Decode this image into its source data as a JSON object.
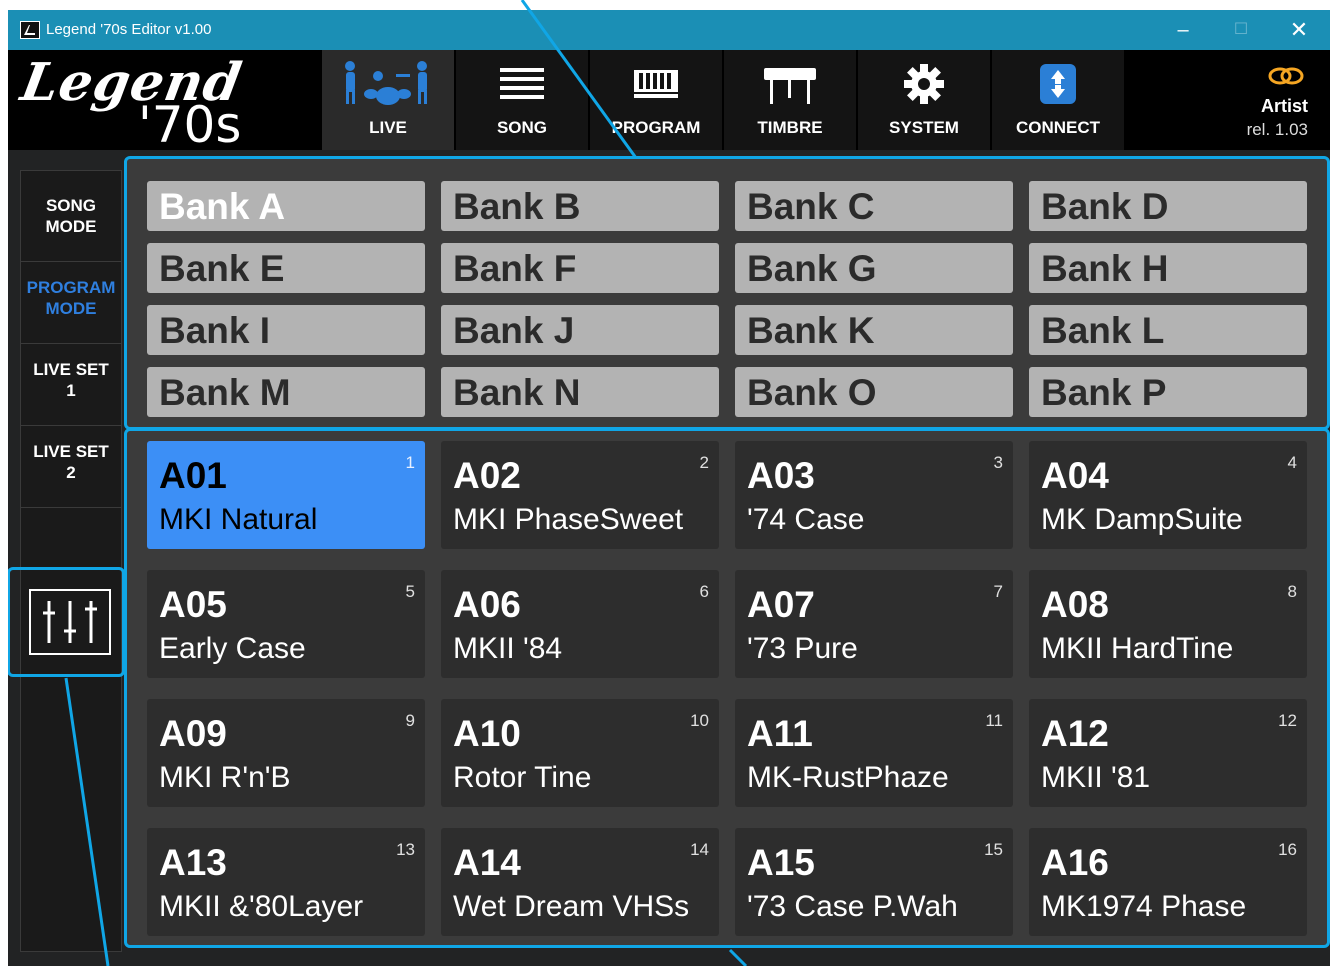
{
  "window": {
    "title": "Legend '70s Editor v1.00",
    "min": "–",
    "max": "☐",
    "close": "✕"
  },
  "logo": {
    "word": "Legend",
    "era": "'70s"
  },
  "tabs": [
    {
      "label": "LIVE",
      "icon": "band-icon",
      "active": true
    },
    {
      "label": "SONG",
      "icon": "list-icon"
    },
    {
      "label": "PROGRAM",
      "icon": "keyboard-icon"
    },
    {
      "label": "TIMBRE",
      "icon": "piano-icon"
    },
    {
      "label": "SYSTEM",
      "icon": "gear-icon"
    },
    {
      "label": "CONNECT",
      "icon": "connect-icon"
    }
  ],
  "account": {
    "level": "Artist",
    "release": "rel. 1.03"
  },
  "sidebar": [
    {
      "line1": "SONG",
      "line2": "MODE"
    },
    {
      "line1": "PROGRAM",
      "line2": "MODE",
      "active": true
    },
    {
      "line1": "LIVE SET",
      "line2": "1"
    },
    {
      "line1": "LIVE SET",
      "line2": "2"
    }
  ],
  "banks": [
    "Bank A",
    "Bank B",
    "Bank C",
    "Bank D",
    "Bank E",
    "Bank F",
    "Bank G",
    "Bank H",
    "Bank I",
    "Bank J",
    "Bank K",
    "Bank L",
    "Bank M",
    "Bank N",
    "Bank O",
    "Bank P"
  ],
  "selected_bank": "Bank A",
  "programs": [
    {
      "code": "A01",
      "name": "MKI Natural",
      "num": "1"
    },
    {
      "code": "A02",
      "name": "MKI PhaseSweet",
      "num": "2"
    },
    {
      "code": "A03",
      "name": "'74 Case",
      "num": "3"
    },
    {
      "code": "A04",
      "name": "MK DampSuite",
      "num": "4"
    },
    {
      "code": "A05",
      "name": "Early Case",
      "num": "5"
    },
    {
      "code": "A06",
      "name": "MKII '84",
      "num": "6"
    },
    {
      "code": "A07",
      "name": "'73 Pure",
      "num": "7"
    },
    {
      "code": "A08",
      "name": "MKII HardTine",
      "num": "8"
    },
    {
      "code": "A09",
      "name": "MKI R'n'B",
      "num": "9"
    },
    {
      "code": "A10",
      "name": "Rotor Tine",
      "num": "10"
    },
    {
      "code": "A11",
      "name": "MK-RustPhaze",
      "num": "11"
    },
    {
      "code": "A12",
      "name": "MKII '81",
      "num": "12"
    },
    {
      "code": "A13",
      "name": "MKII &'80Layer",
      "num": "13"
    },
    {
      "code": "A14",
      "name": "Wet Dream VHSs",
      "num": "14"
    },
    {
      "code": "A15",
      "name": "'73 Case P.Wah",
      "num": "15"
    },
    {
      "code": "A16",
      "name": "MK1974 Phase",
      "num": "16"
    }
  ],
  "selected_program": "A01",
  "colors": {
    "accent": "#10a6e6",
    "selected": "#3c8ff6",
    "titlebar": "#1b8fb5"
  }
}
